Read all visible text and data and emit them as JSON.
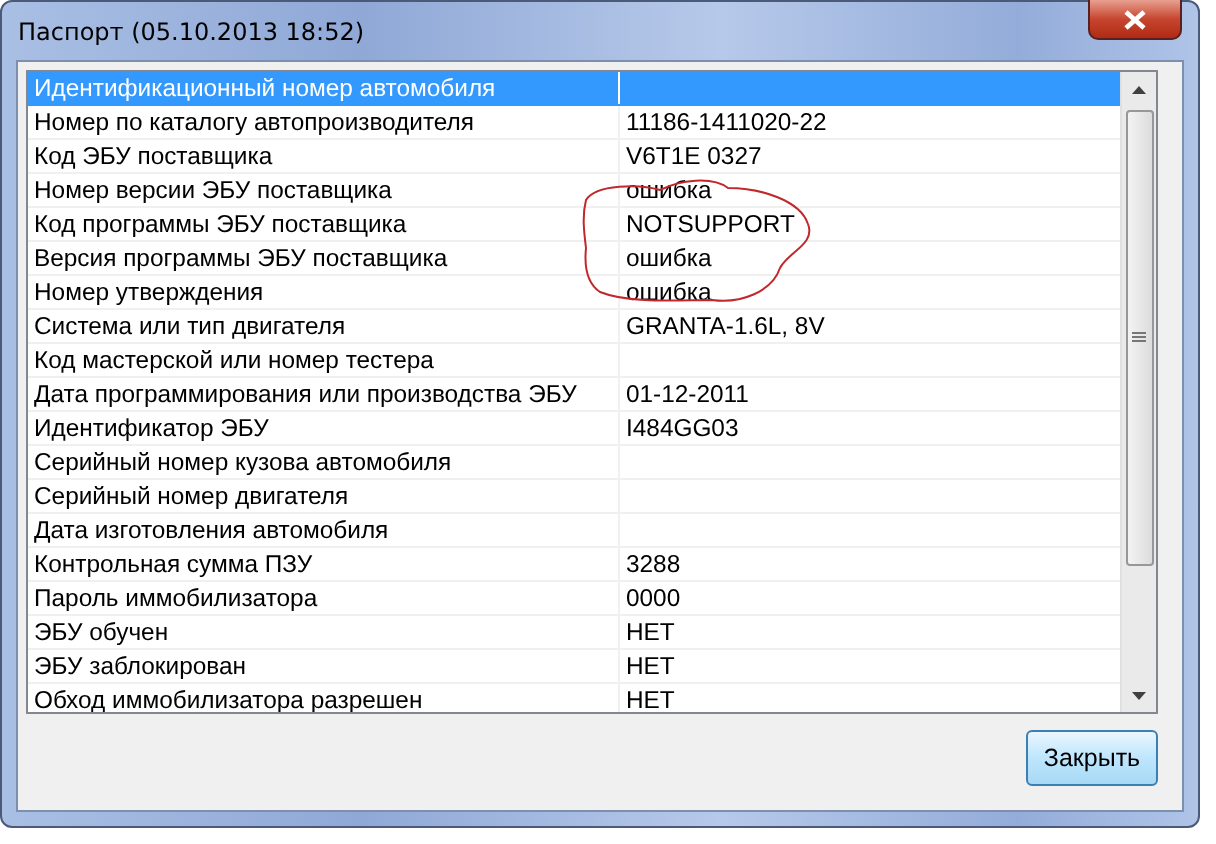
{
  "window": {
    "title": "Паспорт (05.10.2013 18:52)"
  },
  "table": {
    "rows": [
      {
        "name": "Идентификационный номер автомобиля",
        "selected": true
      },
      {
        "name": "Номер по каталогу автопроизводителя",
        "value": "11186-1411020-22",
        "selected": false
      },
      {
        "name": "Код ЭБУ поставщика",
        "value": "V6T1E 0327",
        "selected": false
      },
      {
        "name": "Номер версии ЭБУ поставщика",
        "value": "ошибка",
        "selected": false
      },
      {
        "name": "Код программы ЭБУ поставщика",
        "value": "NOTSUPPORT",
        "selected": false
      },
      {
        "name": "Версия программы ЭБУ поставщика",
        "value": "ошибка",
        "selected": false
      },
      {
        "name": "Номер утверждения",
        "value": "ошибка",
        "selected": false
      },
      {
        "name": "Система или тип двигателя",
        "value": "GRANTA-1.6L, 8V",
        "selected": false
      },
      {
        "name": "Код мастерской или номер тестера",
        "selected": false
      },
      {
        "name": "Дата программирования или производства ЭБУ",
        "value": "01-12-2011",
        "selected": false
      },
      {
        "name": "Идентификатор ЭБУ",
        "value": "I484GG03",
        "selected": false
      },
      {
        "name": "Серийный номер кузова автомобиля",
        "selected": false
      },
      {
        "name": "Серийный номер двигателя",
        "selected": false
      },
      {
        "name": "Дата изготовления автомобиля",
        "selected": false
      },
      {
        "name": "Контрольная сумма ПЗУ",
        "value": "3288",
        "selected": false
      },
      {
        "name": "Пароль иммобилизатора",
        "value": "0000",
        "selected": false
      },
      {
        "name": "ЭБУ обучен",
        "value": "НЕТ",
        "selected": false
      },
      {
        "name": "ЭБУ заблокирован",
        "value": "НЕТ",
        "selected": false
      },
      {
        "name": "Обход иммобилизатора разрешен",
        "value": "НЕТ",
        "selected": false
      }
    ]
  },
  "buttons": [
    "Закрыть"
  ]
}
